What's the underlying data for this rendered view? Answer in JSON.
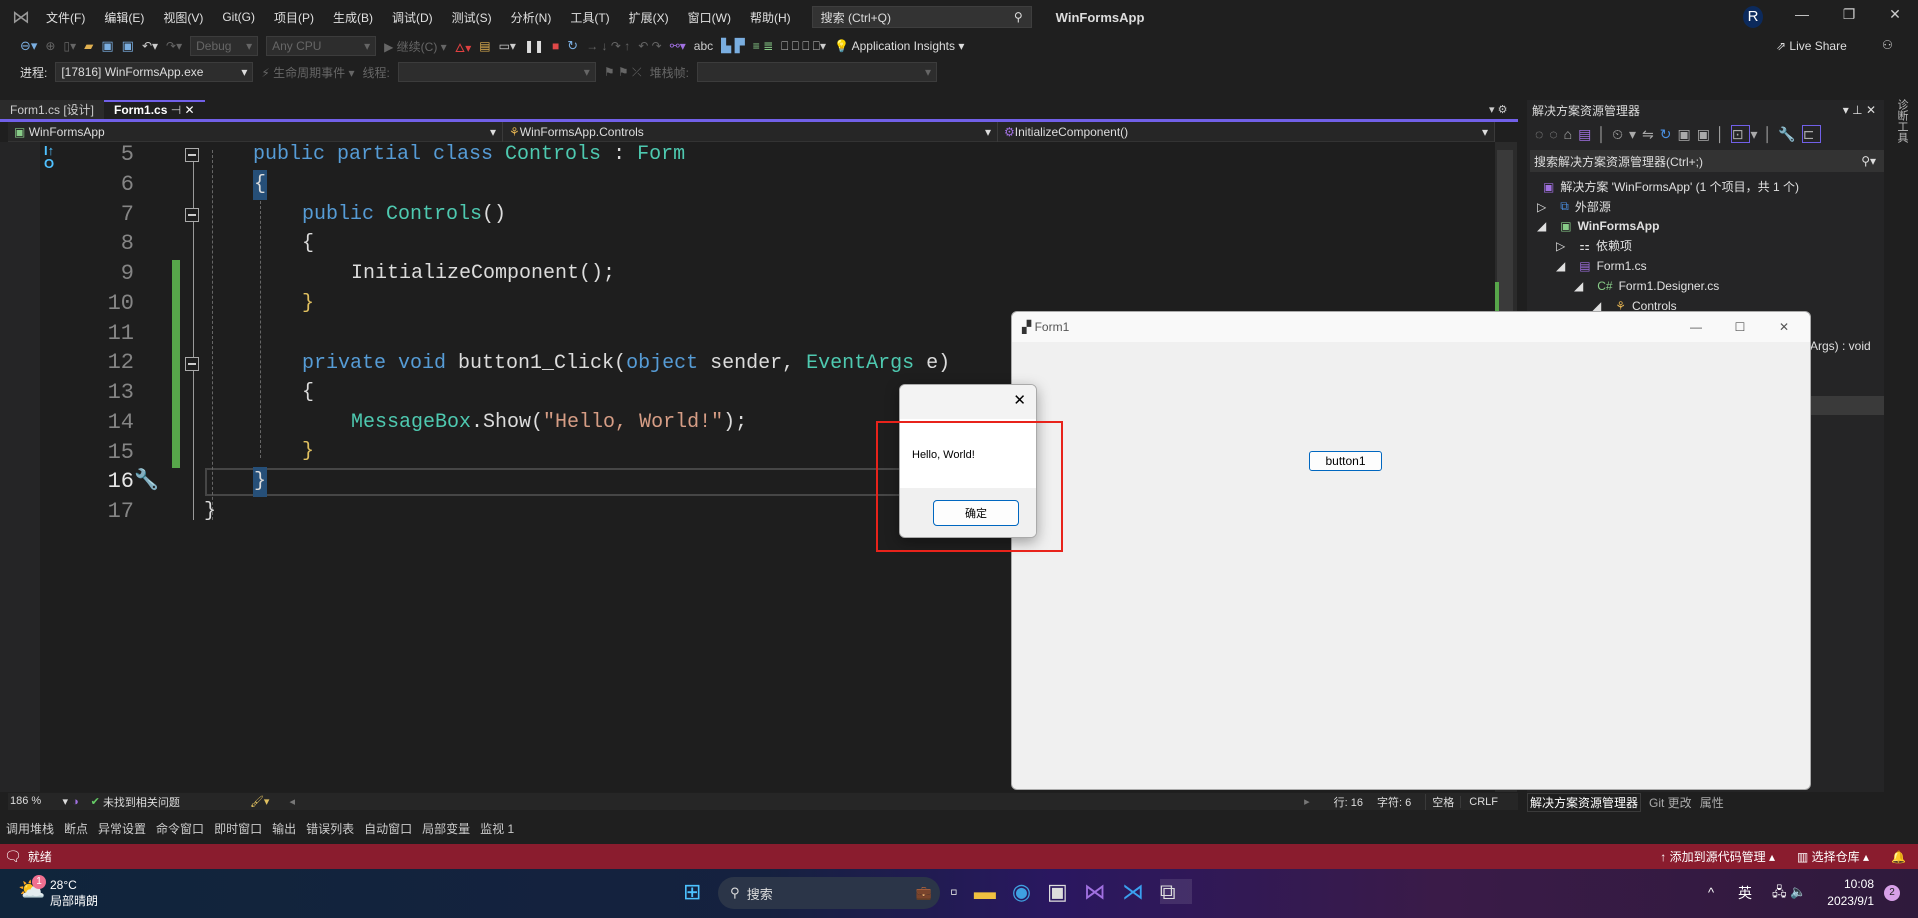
{
  "menubar": {
    "items": [
      "文件(F)",
      "编辑(E)",
      "视图(V)",
      "Git(G)",
      "项目(P)",
      "生成(B)",
      "调试(D)",
      "测试(S)",
      "分析(N)",
      "工具(T)",
      "扩展(X)",
      "窗口(W)",
      "帮助(H)"
    ],
    "search_placeholder": "搜索 (Ctrl+Q)",
    "app_title": "WinFormsApp",
    "avatar": "R"
  },
  "toolbar": {
    "config": "Debug",
    "platform": "Any CPU",
    "continue": "继续(C)",
    "app_insights": "Application Insights",
    "live_share": "Live Share"
  },
  "debugbar": {
    "process_label": "进程:",
    "process": "[17816] WinFormsApp.exe",
    "lifecycle": "生命周期事件",
    "thread_label": "线程:",
    "stack_label": "堆栈帧:"
  },
  "tabs": [
    {
      "label": "Form1.cs [设计]"
    },
    {
      "label": "Form1.cs"
    }
  ],
  "nav": {
    "project": "WinFormsApp",
    "class": "WinFormsApp.Controls",
    "member": "InitializeComponent()"
  },
  "code": {
    "lines": [
      {
        "n": "5"
      },
      {
        "n": "6"
      },
      {
        "n": "7"
      },
      {
        "n": "8"
      },
      {
        "n": "9"
      },
      {
        "n": "10"
      },
      {
        "n": "11"
      },
      {
        "n": "12"
      },
      {
        "n": "13"
      },
      {
        "n": "14"
      },
      {
        "n": "15"
      },
      {
        "n": "16"
      },
      {
        "n": "17"
      }
    ],
    "t": {
      "l5a": "public partial class ",
      "l5b": "Controls",
      ":": " : ",
      "l5c": "Form",
      "l6": "{",
      "l7a": "public ",
      "l7b": "Controls",
      "l7c": "()",
      "l8": "{",
      "l9": "InitializeComponent();",
      "l10": "}",
      "l12a": "private void ",
      "l12b": "button1_Click(",
      "l12c": "object",
      "l12d": " sender, ",
      "l12e": "EventArgs",
      "l12f": " e)",
      "l13": "{",
      "l14a": "MessageBox",
      "l14b": ".Show(",
      "l14c": "\"Hello, World!\"",
      "l14d": ");",
      "l15": "}",
      "l16": "}",
      "l17": "}"
    }
  },
  "solution_explorer": {
    "title": "解决方案资源管理器",
    "search_placeholder": "搜索解决方案资源管理器(Ctrl+;)",
    "items": [
      "解决方案 'WinFormsApp' (1 个项目，共 1 个)",
      "外部源",
      "WinFormsApp",
      "依赖项",
      "Form1.cs",
      "Form1.Designer.cs",
      "Controls"
    ],
    "partial": "Args) : void",
    "side_tab": "诊断工具"
  },
  "editor_status": {
    "zoom": "186 %",
    "issues": "未找到相关问题",
    "line": "行: 16",
    "char": "字符: 6",
    "spaces": "空格",
    "eol": "CRLF"
  },
  "panel_tabs": [
    "解决方案资源管理器",
    "Git 更改",
    "属性"
  ],
  "tool_windows": [
    "调用堆栈",
    "断点",
    "异常设置",
    "命令窗口",
    "即时窗口",
    "输出",
    "错误列表",
    "自动窗口",
    "局部变量",
    "监视 1"
  ],
  "statusbar": {
    "ready": "就绪",
    "source_control": "添加到源代码管理",
    "repo": "选择仓库"
  },
  "form1": {
    "title": "Form1",
    "button": "button1"
  },
  "messagebox": {
    "text": "Hello, World!",
    "ok": "确定"
  },
  "taskbar": {
    "temp": "28°C",
    "weather": "局部晴朗",
    "badge": "1",
    "search": "搜索",
    "ime": "英",
    "time": "10:08",
    "date": "2023/9/1",
    "notif": "2"
  },
  "colors": {
    "accent": "#7160e8",
    "status_bar": "#8a1c2e",
    "highlight": "#e8231b"
  }
}
